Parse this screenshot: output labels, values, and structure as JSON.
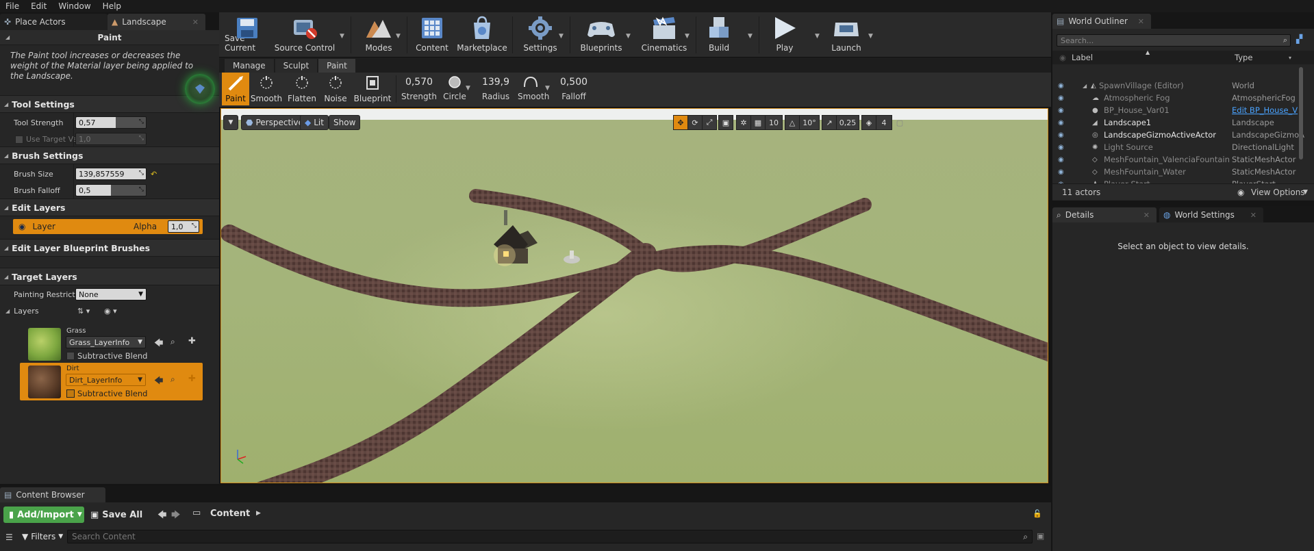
{
  "menu": [
    "File",
    "Edit",
    "Window",
    "Help"
  ],
  "left_tabs": [
    {
      "label": "Place Actors"
    },
    {
      "label": "Landscape"
    }
  ],
  "paint_panel": {
    "title": "Paint",
    "description": "The Paint tool increases or decreases the weight of the Material layer being applied to the Landscape.",
    "tool_settings": {
      "header": "Tool Settings",
      "strength_label": "Tool Strength",
      "strength_value": "0,57",
      "strength_fraction": 0.57,
      "target_label": "Use Target Va",
      "target_value": "1,0"
    },
    "brush_settings": {
      "header": "Brush Settings",
      "size_label": "Brush Size",
      "size_value": "139,857559",
      "falloff_label": "Brush Falloff",
      "falloff_value": "0,5",
      "falloff_fraction": 0.5
    },
    "edit_layers": {
      "header": "Edit Layers",
      "layer_name": "Layer",
      "alpha_label": "Alpha",
      "alpha_value": "1,0"
    },
    "blueprint_brushes": {
      "header": "Edit Layer Blueprint Brushes"
    },
    "target_layers": {
      "header": "Target Layers",
      "restriction_label": "Painting Restricti",
      "restriction_value": "None",
      "layers_label": "Layers",
      "layers": [
        {
          "name": "Grass",
          "info": "Grass_LayerInfo",
          "blend": "Subtractive Blend",
          "selected": false
        },
        {
          "name": "Dirt",
          "info": "Dirt_LayerInfo",
          "blend": "Subtractive Blend",
          "selected": true
        }
      ]
    }
  },
  "toolbar": [
    {
      "label": "Save Current"
    },
    {
      "label": "Source Control"
    },
    {
      "label": "Modes"
    },
    {
      "label": "Content"
    },
    {
      "label": "Marketplace"
    },
    {
      "label": "Settings"
    },
    {
      "label": "Blueprints"
    },
    {
      "label": "Cinematics"
    },
    {
      "label": "Build"
    },
    {
      "label": "Play"
    },
    {
      "label": "Launch"
    }
  ],
  "mode_tabs": [
    "Manage",
    "Sculpt",
    "Paint"
  ],
  "tools": [
    {
      "label": "Paint"
    },
    {
      "label": "Smooth"
    },
    {
      "label": "Flatten"
    },
    {
      "label": "Noise"
    },
    {
      "label": "Blueprint"
    }
  ],
  "brush_stats": [
    {
      "value": "0,570",
      "label": "Strength"
    },
    {
      "value": "",
      "label": "Circle"
    },
    {
      "value": "139,9",
      "label": "Radius"
    },
    {
      "value": "",
      "label": "Smooth"
    },
    {
      "value": "0,500",
      "label": "Falloff"
    }
  ],
  "viewport": {
    "view_mode": "Perspective",
    "lighting": "Lit",
    "show": "Show",
    "grid_snap": "10",
    "rotation_snap": "10°",
    "scale_snap": "0,25",
    "camera_speed": "4"
  },
  "outliner": {
    "title": "World Outliner",
    "search_placeholder": "Search...",
    "col_label": "Label",
    "col_type": "Type",
    "rows": [
      {
        "name": "SpawnVillage (Editor)",
        "type": "World",
        "style": "dim"
      },
      {
        "name": "Atmospheric Fog",
        "type": "AtmosphericFog",
        "style": "dim"
      },
      {
        "name": "BP_House_Var01",
        "type": "Edit BP_House_V",
        "style": "dim"
      },
      {
        "name": "Landscape1",
        "type": "Landscape",
        "style": "bright"
      },
      {
        "name": "LandscapeGizmoActiveActor",
        "type": "LandscapeGizmoA",
        "style": "bright"
      },
      {
        "name": "Light Source",
        "type": "DirectionalLight",
        "style": "dim"
      },
      {
        "name": "MeshFountain_ValenciaFountain",
        "type": "StaticMeshActor",
        "style": "dim"
      },
      {
        "name": "MeshFountain_Water",
        "type": "StaticMeshActor",
        "style": "dim"
      },
      {
        "name": "Player Start",
        "type": "PlayerStart",
        "style": "dim"
      }
    ],
    "actor_count": "11 actors",
    "view_options": "View Options"
  },
  "details": {
    "tabs": [
      {
        "label": "Details"
      },
      {
        "label": "World Settings"
      }
    ],
    "empty_text": "Select an object to view details."
  },
  "content_browser": {
    "tab": "Content Browser",
    "add_import": "Add/Import",
    "save_all": "Save All",
    "path": "Content",
    "filters": "Filters",
    "search_placeholder": "Search Content"
  },
  "colors": {
    "accent": "#e08a10",
    "link": "#4aa3ff",
    "ground": "#a9b57e",
    "road": "#5e4540"
  }
}
